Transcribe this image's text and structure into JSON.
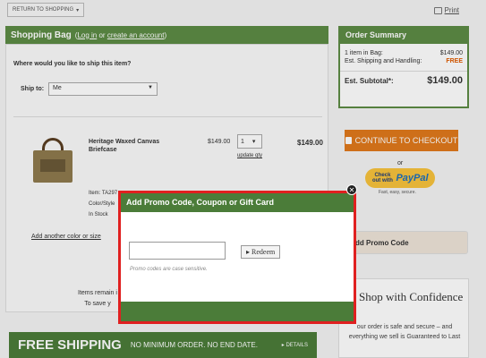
{
  "top": {
    "return_label": "RETURN TO SHOPPING",
    "print_label": "Print"
  },
  "bag": {
    "title": "Shopping Bag",
    "paren_open": "(",
    "login_link": "Log in",
    "or_text": "or",
    "create_link": "create an account",
    "paren_close": ")",
    "ship_question": "Where would you like to ship this item?",
    "ship_to_label": "Ship to:",
    "ship_to_value": "Me"
  },
  "item": {
    "name": "Heritage Waxed Canvas Briefcase",
    "unit_price": "$149.00",
    "qty": "1",
    "update_qty": "update qty",
    "total": "$149.00",
    "details": [
      "Item: TA297",
      "Color/Style",
      "In Stock"
    ],
    "add_another": "Add another color or size"
  },
  "notice": {
    "line1": "Items remain i",
    "line2": "To save y"
  },
  "banner": {
    "big": "FREE SHIPPING",
    "small": "NO MINIMUM ORDER. NO END DATE.",
    "details": "DETAILS"
  },
  "summary": {
    "title": "Order Summary",
    "items_label": "1 item in Bag:",
    "items_value": "$149.00",
    "shipping_label": "Est. Shipping and Handling:",
    "shipping_value": "FREE",
    "subtotal_label": "Est. Subtotal*:",
    "subtotal_value": "$149.00"
  },
  "checkout": {
    "label": "CONTINUE TO CHECKOUT",
    "or": "or",
    "paypal_pre": "Check out with",
    "paypal_brand": "PayPal",
    "paypal_tag": "Fast, easy, secure."
  },
  "promo_side": {
    "label": "dd Promo Code"
  },
  "confidence": {
    "title": "Shop with Confidence",
    "text": "our order is safe and secure – and everything we sell is Guaranteed to Last"
  },
  "modal": {
    "title": "Add Promo Code, Coupon or Gift Card",
    "input_value": "",
    "redeem_label": "Redeem",
    "note": "Promo codes are case sensitive."
  },
  "colors": {
    "brand_green": "#5d8b45",
    "checkout_orange": "#e0791c",
    "highlight_red": "#e02020"
  }
}
